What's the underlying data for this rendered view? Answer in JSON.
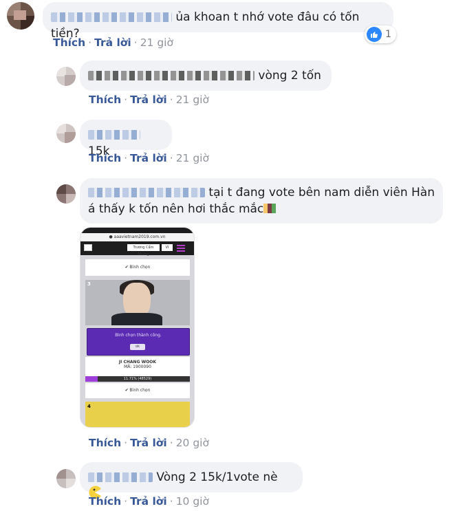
{
  "comments": [
    {
      "text": "ủa khoan t nhớ vote đâu có tốn tiền?",
      "reaction_count": "1",
      "actions": {
        "like": "Thích",
        "reply": "Trả lời",
        "time": "21 giờ"
      }
    },
    {
      "text": "vòng 2 tốn",
      "actions": {
        "like": "Thích",
        "reply": "Trả lời",
        "time": "21 giờ"
      }
    },
    {
      "text": "15k",
      "actions": {
        "like": "Thích",
        "reply": "Trả lời",
        "time": "21 giờ"
      }
    },
    {
      "text_line1": "tại t đang vote bên nam diễn viên Hàn",
      "text_line2": "á thấy k tốn nên hơi thắc mắc",
      "actions": {
        "like": "Thích",
        "reply": "Trả lời",
        "time": "20 giờ"
      }
    },
    {
      "text": "Vòng 2 15k/1vote nè",
      "emoji": "pacman-emoji",
      "actions": {
        "like": "Thích",
        "reply": "Trả lời",
        "time": "10 giờ"
      }
    }
  ],
  "screenshot": {
    "url": "aaavietnam2019.com.vn",
    "selector": "Trương Cẩm Nhung",
    "lang": "VI",
    "vote_label": "Bình chọn",
    "item_number_top": "3",
    "modal_text": "Bình chọn thành công.",
    "modal_ok": "ok",
    "name": "JI CHANG WOOK",
    "code": "MÃ: 1900090",
    "progress_text": "11.71% (48529)",
    "progress_fraction": 0.117,
    "vote_label_2": "Bình chọn",
    "item_number_bottom": "4"
  },
  "colors": {
    "link": "#385898",
    "bubble": "#f0f2f5",
    "like": "#2d88ff"
  }
}
